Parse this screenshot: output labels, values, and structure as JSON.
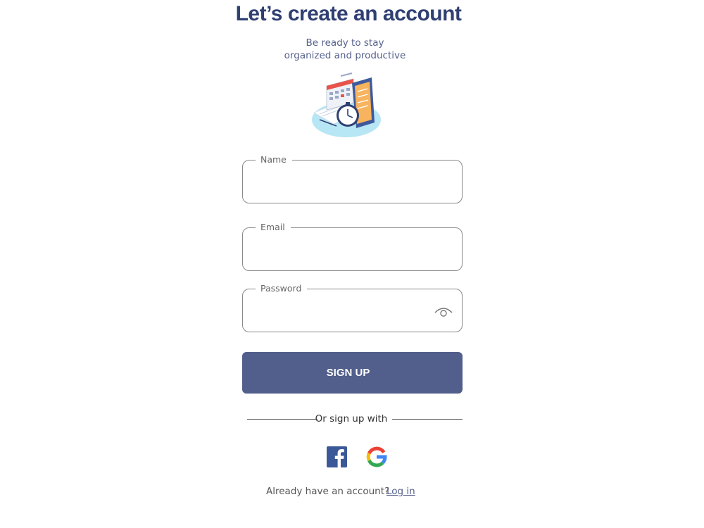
{
  "header": {
    "title": "Let’s create an account",
    "subtitle_line1": "Be ready to stay",
    "subtitle_line2": "organized and productive"
  },
  "form": {
    "name_label": "Name",
    "email_label": "Email",
    "password_label": "Password",
    "name_value": "",
    "email_value": "",
    "password_value": "",
    "signup_label": "SIGN UP"
  },
  "social": {
    "divider_text": "Or sign up with",
    "icons": [
      "facebook-icon",
      "google-icon"
    ]
  },
  "footer": {
    "prompt": "Already have an account?",
    "login_label": "Log in"
  },
  "colors": {
    "primary": "#525e8b",
    "title": "#2f3f72",
    "facebook": "#3b5998"
  }
}
